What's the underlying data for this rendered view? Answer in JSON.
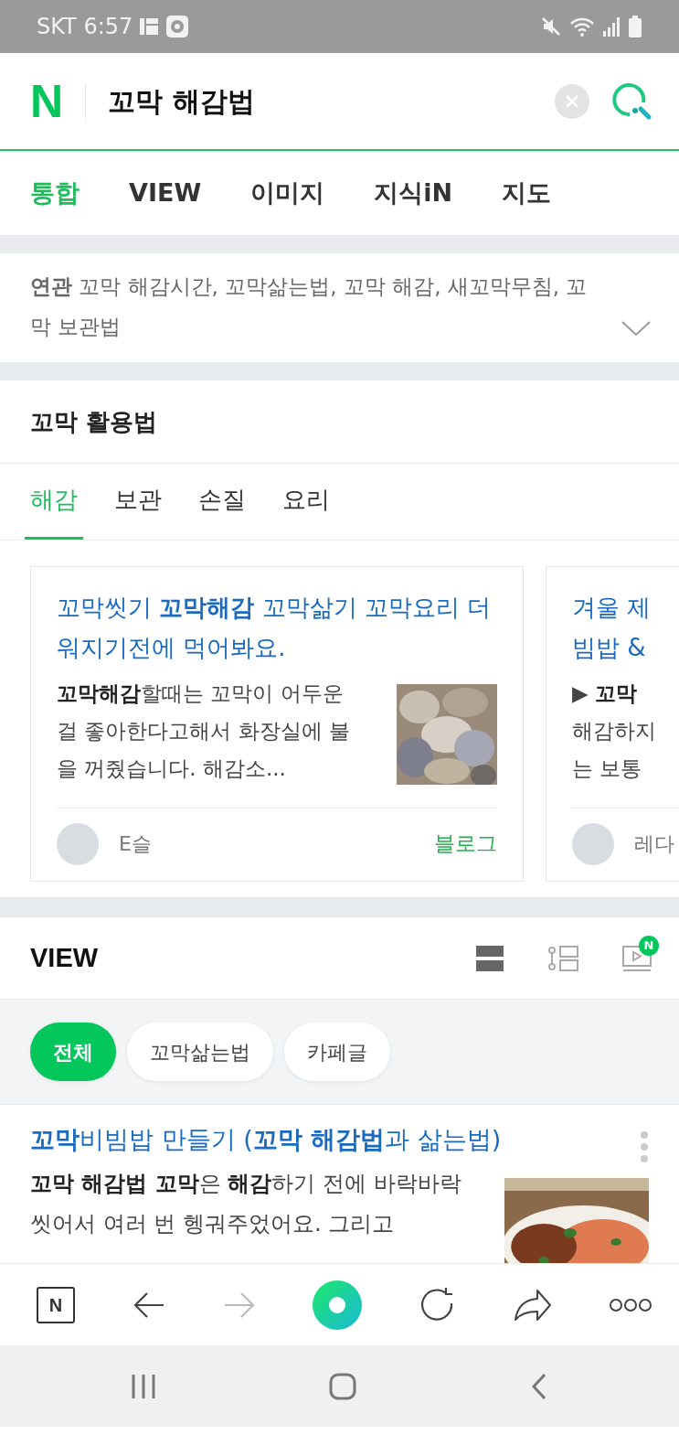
{
  "status_bar": {
    "carrier_time": "SKT 6:57"
  },
  "search": {
    "logo": "N",
    "query": "꼬막 해감법"
  },
  "tabs": [
    {
      "label": "통합",
      "selected": true
    },
    {
      "label": "VIEW",
      "selected": false
    },
    {
      "label": "이미지",
      "selected": false
    },
    {
      "label": "지식iN",
      "selected": false
    },
    {
      "label": "지도",
      "selected": false
    }
  ],
  "related": {
    "label": "연관",
    "text": "꼬막 해감시간, 꼬막삶는법, 꼬막 해감, 새꼬막무침, 꼬막 보관법"
  },
  "tips": {
    "title": "꼬막 활용법",
    "subtabs": [
      {
        "label": "해감",
        "selected": true
      },
      {
        "label": "보관",
        "selected": false
      },
      {
        "label": "손질",
        "selected": false
      },
      {
        "label": "요리",
        "selected": false
      }
    ],
    "cards": [
      {
        "title": "꼬막씻기 **꼬막해감** 꼬막삶기 꼬막요리 더워지기전에 먹어봐요.",
        "description": "**꼬막해감**할때는 꼬막이 어두운걸 좋아한다고해서 화장실에 불을 꺼줬습니다. 해감소...",
        "author": "E슬",
        "source": "블로그"
      },
      {
        "title_lines": [
          "겨울 제",
          "빔밥 &"
        ],
        "description_lines": [
          "▶ **꼬막**",
          "해감하지",
          "는 보통"
        ],
        "author": "레다"
      }
    ]
  },
  "view": {
    "title": "VIEW",
    "video_badge": "N",
    "filters": [
      {
        "label": "전체",
        "selected": true
      },
      {
        "label": "꼬막삶는법",
        "selected": false
      },
      {
        "label": "카페글",
        "selected": false
      }
    ],
    "results": [
      {
        "title": "**꼬막**비빔밥 만들기 (**꼬막 해감법**과 삶는법)",
        "description": "**꼬막 해감법 꼬막**은 **해감**하기 전에 바락바락 씻어서 여러 번 헹궈주었어요. 그리고"
      }
    ]
  },
  "toolbar": {
    "home_logo": "N"
  }
}
